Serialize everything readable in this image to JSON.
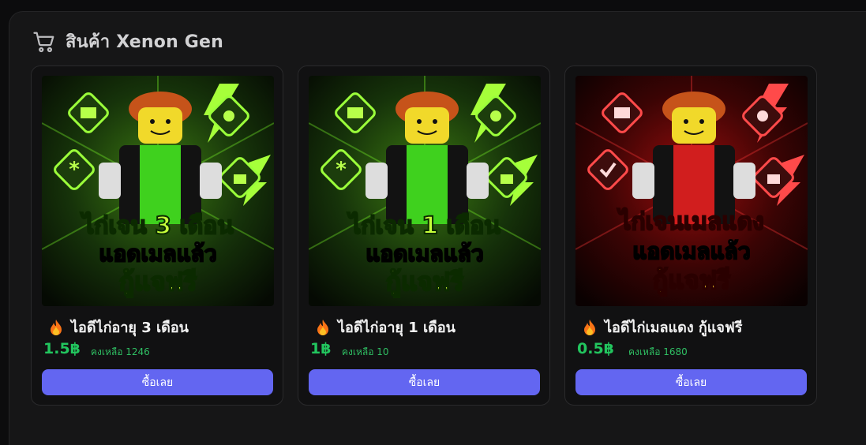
{
  "section": {
    "icon": "shopping-cart-icon",
    "title": "สินค้า Xenon Gen"
  },
  "products": [
    {
      "banner": {
        "line1": "ไก่เจน 3 เดือน",
        "line2": "แอดเมลแล้ว",
        "line3": "กู้แจฟรี",
        "theme": "green"
      },
      "name": "ไอดีไก่อายุ 3 เดือน",
      "price": "1.5฿",
      "stock": "คงเหลือ 1246",
      "buy_label": "ซื้อเลย"
    },
    {
      "banner": {
        "line1": "ไก่เจน 1 เดือน",
        "line2": "แอดเมลแล้ว",
        "line3": "กู้แจฟรี",
        "theme": "green"
      },
      "name": "ไอดีไก่อายุ 1 เดือน",
      "price": "1฿",
      "stock": "คงเหลือ 10",
      "buy_label": "ซื้อเลย"
    },
    {
      "banner": {
        "line1": "ไก่เจนเมลแดง",
        "line2": "แอดเมลแล้ว",
        "line3": "กู้แจฟรี",
        "theme": "red"
      },
      "name": "ไอดีไก่เมลแดง กู้แจฟรี",
      "price": "0.5฿",
      "stock": "คงเหลือ 1680",
      "buy_label": "ซื้อเลย"
    }
  ],
  "colors": {
    "accent_button": "#6366f1",
    "price_green": "#22c55e",
    "banner_green": "#7dff2a",
    "banner_red": "#ff2a2a",
    "background": "#161617"
  }
}
